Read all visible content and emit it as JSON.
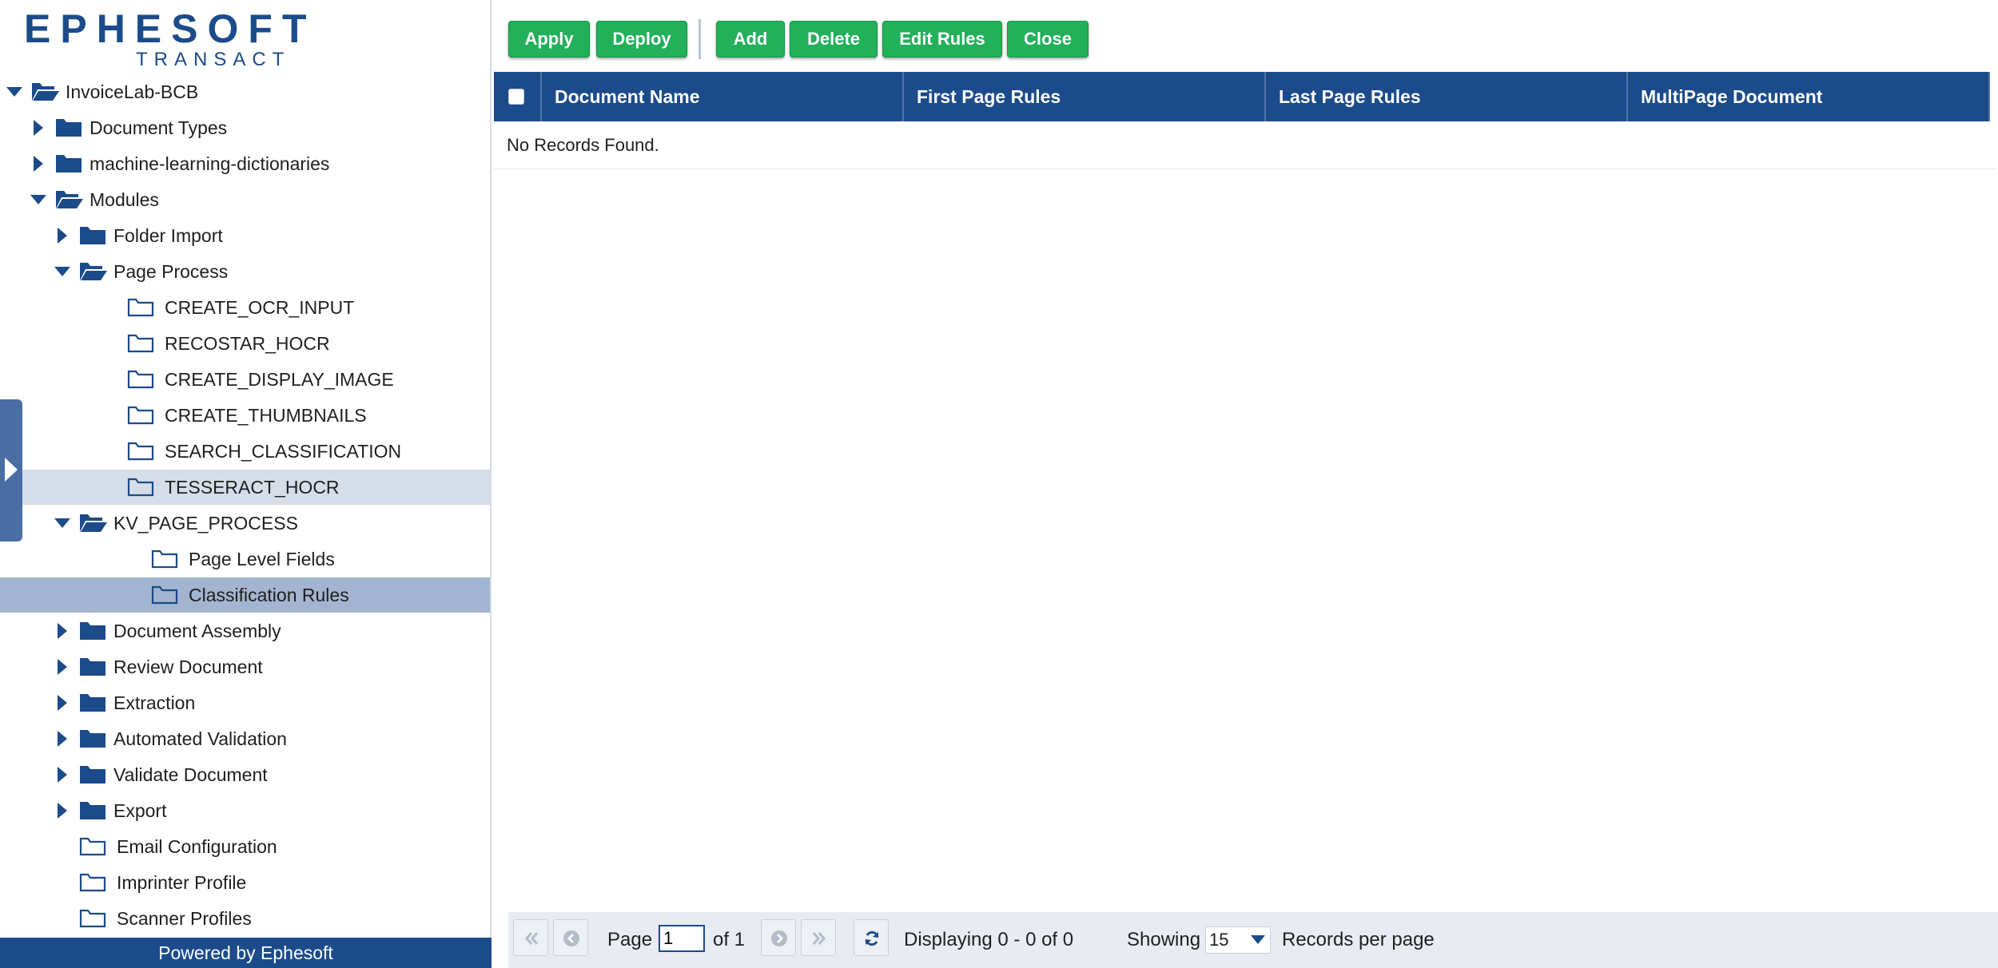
{
  "brand": {
    "logo_word": "EPHESOFT",
    "logo_sub": "TRANSACT",
    "footer": "Powered by Ephesoft"
  },
  "tree": [
    {
      "label": "InvoiceLab-BCB",
      "toggle": "expanded",
      "folder": "open"
    },
    {
      "label": "Document Types",
      "toggle": "collapsed",
      "folder": "closed"
    },
    {
      "label": "machine-learning-dictionaries",
      "toggle": "collapsed",
      "folder": "closed"
    },
    {
      "label": "Modules",
      "toggle": "expanded",
      "folder": "open"
    },
    {
      "label": "Folder Import",
      "toggle": "collapsed",
      "folder": "closed"
    },
    {
      "label": "Page Process",
      "toggle": "expanded",
      "folder": "open"
    },
    {
      "label": "CREATE_OCR_INPUT",
      "toggle": "none",
      "folder": "outline"
    },
    {
      "label": "RECOSTAR_HOCR",
      "toggle": "none",
      "folder": "outline"
    },
    {
      "label": "CREATE_DISPLAY_IMAGE",
      "toggle": "none",
      "folder": "outline"
    },
    {
      "label": "CREATE_THUMBNAILS",
      "toggle": "none",
      "folder": "outline"
    },
    {
      "label": "SEARCH_CLASSIFICATION",
      "toggle": "none",
      "folder": "outline"
    },
    {
      "label": "TESSERACT_HOCR",
      "toggle": "none",
      "folder": "outline",
      "state": "hover"
    },
    {
      "label": "KV_PAGE_PROCESS",
      "toggle": "expanded",
      "folder": "open"
    },
    {
      "label": "Page Level Fields",
      "toggle": "none",
      "folder": "outline"
    },
    {
      "label": "Classification Rules",
      "toggle": "none",
      "folder": "outline",
      "state": "selected"
    },
    {
      "label": "Document Assembly",
      "toggle": "collapsed",
      "folder": "closed"
    },
    {
      "label": "Review Document",
      "toggle": "collapsed",
      "folder": "closed"
    },
    {
      "label": "Extraction",
      "toggle": "collapsed",
      "folder": "closed"
    },
    {
      "label": "Automated Validation",
      "toggle": "collapsed",
      "folder": "closed"
    },
    {
      "label": "Validate Document",
      "toggle": "collapsed",
      "folder": "closed"
    },
    {
      "label": "Export",
      "toggle": "collapsed",
      "folder": "closed"
    },
    {
      "label": "Email Configuration",
      "toggle": "none",
      "folder": "outline"
    },
    {
      "label": "Imprinter Profile",
      "toggle": "none",
      "folder": "outline"
    },
    {
      "label": "Scanner Profiles",
      "toggle": "none",
      "folder": "outline"
    }
  ],
  "toolbar": {
    "buttons": [
      "Apply",
      "Deploy",
      "Add",
      "Delete",
      "Edit Rules",
      "Close"
    ]
  },
  "grid": {
    "columns": [
      "Document Name",
      "First Page Rules",
      "Last Page Rules",
      "MultiPage Document"
    ],
    "empty_message": "No Records Found."
  },
  "pager": {
    "page_label": "Page",
    "page_value": "1",
    "of_label": "of 1",
    "displaying": "Displaying 0 - 0 of 0",
    "showing_label": "Showing",
    "per_page_value": "15",
    "per_page_label": "Records per page"
  },
  "colors": {
    "brand_blue": "#1b4b8a",
    "button_green": "#22b05a",
    "row_hover": "#d5dde8",
    "row_selected": "#a2b4cf"
  },
  "icons": [
    "tree-toggle-icon",
    "folder-icon",
    "folder-open-icon",
    "first-page-icon",
    "prev-page-icon",
    "next-page-icon",
    "last-page-icon",
    "refresh-icon",
    "dropdown-arrow-icon"
  ]
}
